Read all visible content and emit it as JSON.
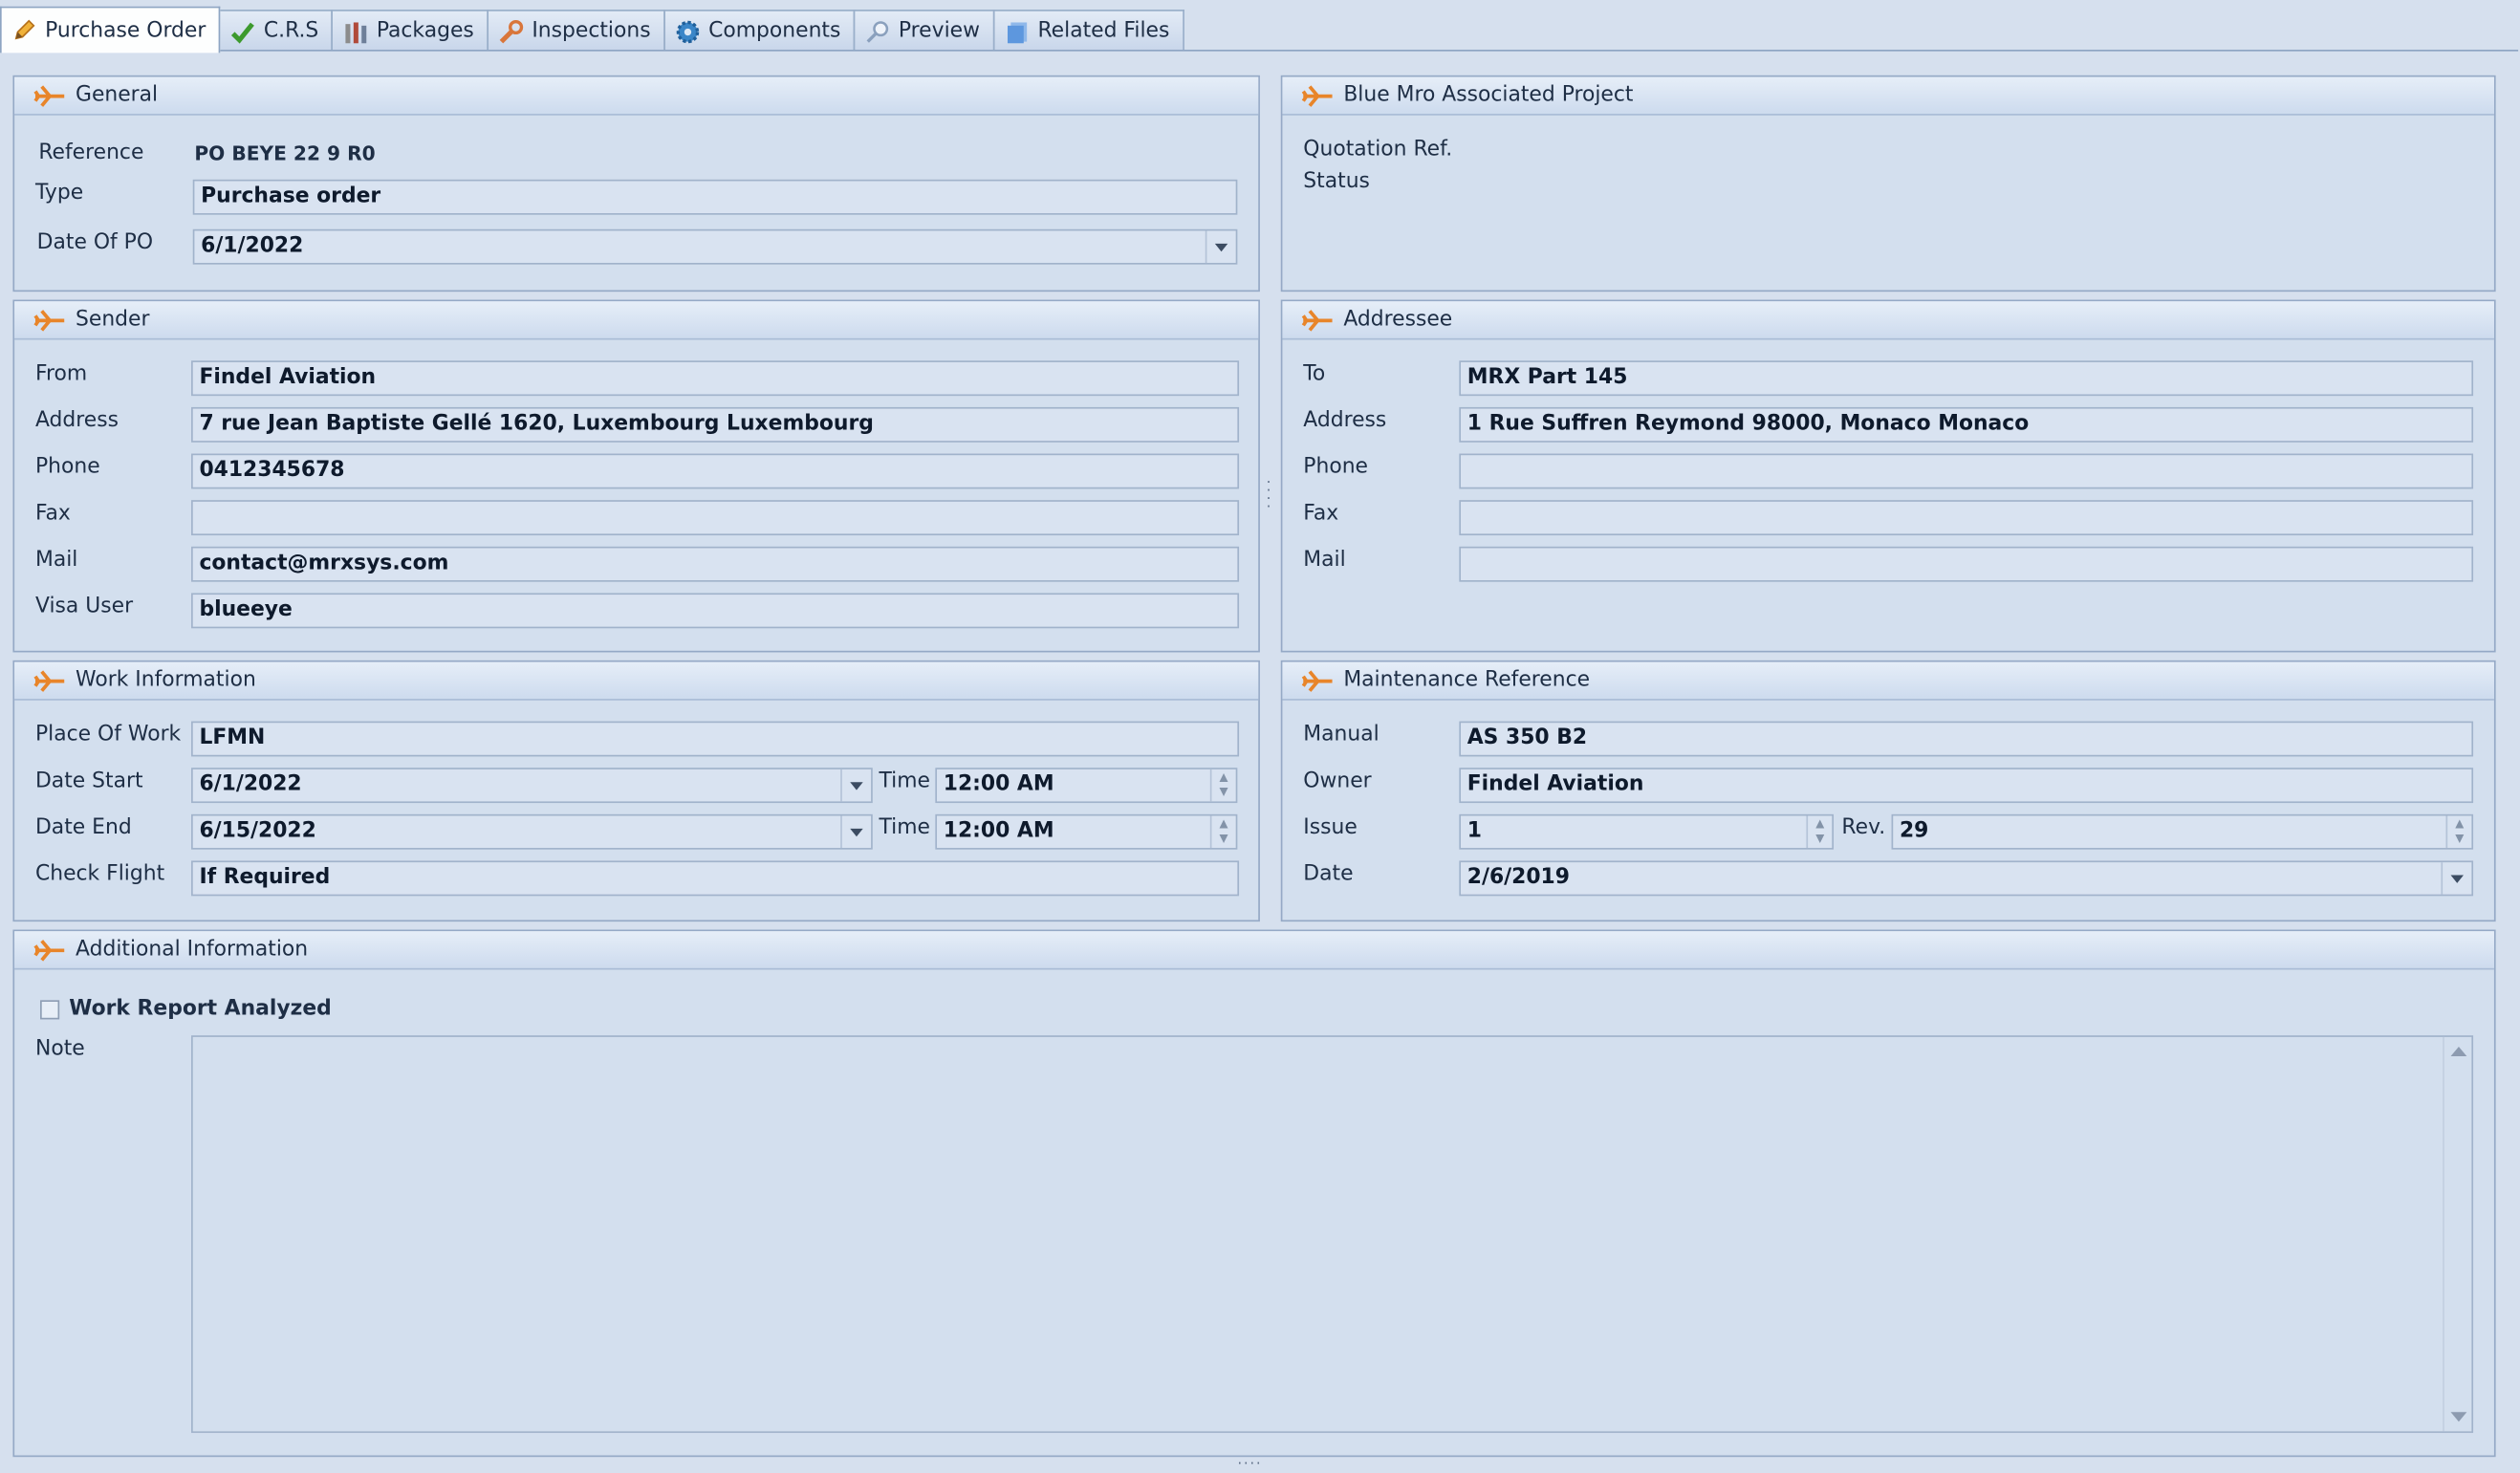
{
  "tabs": [
    {
      "label": "Purchase Order",
      "icon": "pencil-icon",
      "active": true
    },
    {
      "label": "C.R.S",
      "icon": "checkmark-icon",
      "active": false
    },
    {
      "label": "Packages",
      "icon": "packages-icon",
      "active": false
    },
    {
      "label": "Inspections",
      "icon": "wrench-icon",
      "active": false
    },
    {
      "label": "Components",
      "icon": "gear-icon",
      "active": false
    },
    {
      "label": "Preview",
      "icon": "magnifier-icon",
      "active": false
    },
    {
      "label": "Related Files",
      "icon": "files-icon",
      "active": false
    }
  ],
  "general": {
    "title": "General",
    "reference_label": "Reference",
    "reference_value": "PO BEYE 22 9 R0",
    "type_label": "Type",
    "type_value": "Purchase order",
    "date_label": "Date Of PO",
    "date_value": "6/1/2022"
  },
  "project": {
    "title": "Blue Mro Associated Project",
    "quotation_label": "Quotation Ref.",
    "status_label": "Status"
  },
  "sender": {
    "title": "Sender",
    "from_label": "From",
    "from_value": "Findel Aviation",
    "address_label": "Address",
    "address_value": "7 rue Jean Baptiste Gellé 1620, Luxembourg Luxembourg",
    "phone_label": "Phone",
    "phone_value": "0412345678",
    "fax_label": "Fax",
    "fax_value": "",
    "mail_label": "Mail",
    "mail_value": "contact@mrxsys.com",
    "visa_label": "Visa User",
    "visa_value": "blueeye"
  },
  "addressee": {
    "title": "Addressee",
    "to_label": "To",
    "to_value": "MRX Part 145",
    "address_label": "Address",
    "address_value": "1 Rue Suffren Reymond 98000, Monaco Monaco",
    "phone_label": "Phone",
    "phone_value": "",
    "fax_label": "Fax",
    "fax_value": "",
    "mail_label": "Mail",
    "mail_value": ""
  },
  "work": {
    "title": "Work Information",
    "place_label": "Place Of Work",
    "place_value": "LFMN",
    "start_label": "Date Start",
    "start_value": "6/1/2022",
    "end_label": "Date End",
    "end_value": "6/15/2022",
    "time_label": "Time",
    "start_time": "12:00 AM",
    "end_time": "12:00 AM",
    "check_label": "Check Flight",
    "check_value": "If Required"
  },
  "maintenance": {
    "title": "Maintenance Reference",
    "manual_label": "Manual",
    "manual_value": "AS 350 B2",
    "owner_label": "Owner",
    "owner_value": "Findel Aviation",
    "issue_label": "Issue",
    "issue_value": "1",
    "rev_label": "Rev.",
    "rev_value": "29",
    "date_label": "Date",
    "date_value": "2/6/2019"
  },
  "additional": {
    "title": "Additional Information",
    "work_report_label": "Work Report Analyzed",
    "work_report_checked": false,
    "note_label": "Note",
    "note_value": ""
  },
  "colors": {
    "background": "#d6e0ee",
    "accent_plane": "#e8852a",
    "text": "#1e2e45"
  }
}
